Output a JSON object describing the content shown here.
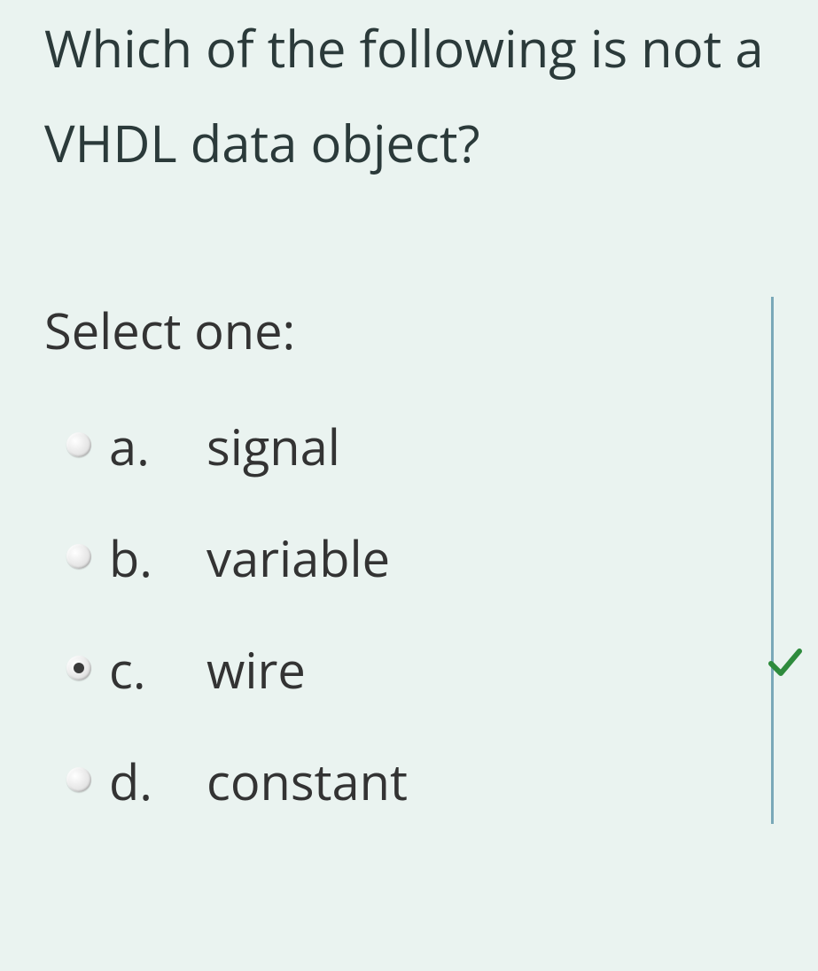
{
  "question": {
    "text": "Which of the following is not a VHDL data object?",
    "prompt": "Select one:",
    "options": [
      {
        "letter": "a.",
        "text": "signal",
        "selected": false
      },
      {
        "letter": "b.",
        "text": "variable",
        "selected": false
      },
      {
        "letter": "c.",
        "text": "wire",
        "selected": true
      },
      {
        "letter": "d.",
        "text": "constant",
        "selected": false
      }
    ],
    "correct_indicator": true
  },
  "colors": {
    "background": "#eaf3f0",
    "text": "#2b3a3a",
    "accent_border": "#7aa8b8",
    "correct": "#2e8b3d"
  }
}
